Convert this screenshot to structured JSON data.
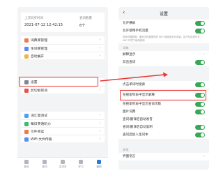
{
  "left_phone": {
    "stats": {
      "last_sync_label": "上次同步时间",
      "last_sync_value": "2021-07-12 12:42:15",
      "vocab_count_label": "查词数量",
      "vocab_count_value": "6个"
    },
    "group1": [
      {
        "label": "词典库管理",
        "icon_color": "#f07a4a"
      },
      {
        "label": "生词库管理",
        "icon_color": "#5b8def"
      },
      {
        "label": "自动展开",
        "icon_color": "#f3b53f"
      }
    ],
    "group2": [
      {
        "label": "设置",
        "icon_color": "#7c8796"
      },
      {
        "label": "剪切板取词",
        "icon_color": "#e8534a"
      }
    ],
    "group3": [
      {
        "label": "词汇量测试",
        "icon_color": "#4aa1f0"
      },
      {
        "label": "每日英语听力",
        "icon_color": "#3cba6e"
      },
      {
        "label": "文件阅读",
        "icon_color": "#f07a4a"
      },
      {
        "label": "WiFi 文件传输",
        "icon_color": "#5b8def"
      }
    ],
    "tabs": [
      "首页",
      "查词",
      "生词本",
      "学习",
      "我的"
    ],
    "active_tab": 4
  },
  "right_phone": {
    "title": "设置",
    "rows_top": [
      {
        "label": "允许横屏",
        "control": "toggle"
      },
      {
        "label": "允许使用手机流量",
        "control": "toggle"
      }
    ],
    "note": "查询词典数据、使用手机数据而非 WiFi 或使用手机流量，如不勾选则仅在 WiFi 环境下使用网络",
    "section_dict": "词典",
    "rows_mid": [
      {
        "label": "解释显示",
        "control": "chevron"
      },
      {
        "label": "双击查词",
        "control": "toggle"
      },
      {
        "label": "点击单词时搜索",
        "control": "toggle"
      }
    ],
    "highlighted_row": {
      "label": "在搜索列表中显示解释",
      "control": "toggle"
    },
    "rows_bottom": [
      {
        "label": "在搜索列表中显示查询次数",
        "control": "toggle"
      },
      {
        "label": "图片词典",
        "control": "toggle"
      },
      {
        "label": "查词/翻译后自动发音",
        "control": "chevron"
      },
      {
        "label": "查词/翻译后自动复制",
        "control": "toggle"
      },
      {
        "label": "查词后加入生词本",
        "control": "toggle"
      }
    ],
    "section_other": "其他",
    "last_row": {
      "label": "界面语言",
      "control": "chevron"
    }
  },
  "colors": {
    "accent_blue": "#2b7bd8",
    "toggle_green": "#3aa657",
    "highlight_red": "#e53935"
  },
  "icons": {
    "back": "‹",
    "chevron": "›"
  }
}
